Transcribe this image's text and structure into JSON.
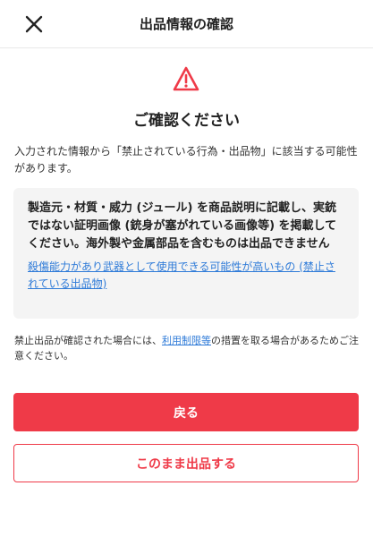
{
  "header": {
    "title": "出品情報の確認",
    "close_icon": "close-icon"
  },
  "dialog": {
    "warning_icon": "warning-triangle-icon",
    "title": "ご確認ください",
    "description": "入力された情報から「禁止されている行為・出品物」に該当する可能性があります。",
    "notice": {
      "text": "製造元・材質・威力 (ジュール) を商品説明に記載し、実銃ではない証明画像 (銃身が塞がれている画像等) を掲載してください。海外製や金属部品を含むものは出品できません",
      "link_text": "殺傷能力があり武器として使用できる可能性が高いもの (禁止されている出品物)"
    },
    "footnote": {
      "before": "禁止出品が確認された場合には、",
      "link": "利用制限等",
      "after": "の措置を取る場合があるためご注意ください。"
    }
  },
  "buttons": {
    "back_label": "戻る",
    "list_label": "このまま出品する"
  },
  "colors": {
    "accent": "#ef3a48",
    "link": "#2f7bd8",
    "notice_bg": "#f4f4f4"
  }
}
